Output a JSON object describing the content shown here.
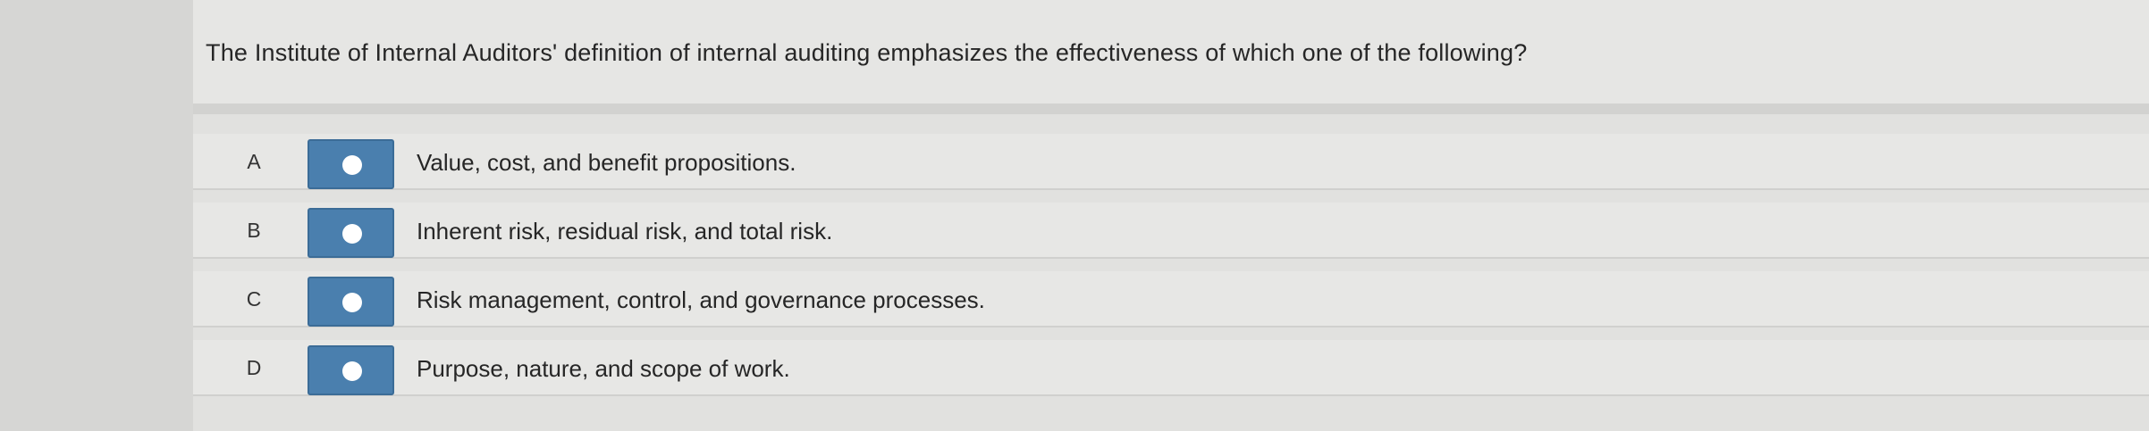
{
  "question": {
    "text": "The Institute of Internal Auditors' definition of internal auditing emphasizes the effectiveness of which one of the following?"
  },
  "options": [
    {
      "letter": "A",
      "text": "Value, cost, and benefit propositions."
    },
    {
      "letter": "B",
      "text": "Inherent risk, residual risk, and total risk."
    },
    {
      "letter": "C",
      "text": "Risk management, control, and governance processes."
    },
    {
      "letter": "D",
      "text": "Purpose, nature, and scope of work."
    }
  ],
  "colors": {
    "radio_button": "#4a7fae",
    "radio_dot": "#ffffff",
    "background": "#d6d6d4"
  },
  "icons": {
    "radio": "radio-circle-icon"
  }
}
